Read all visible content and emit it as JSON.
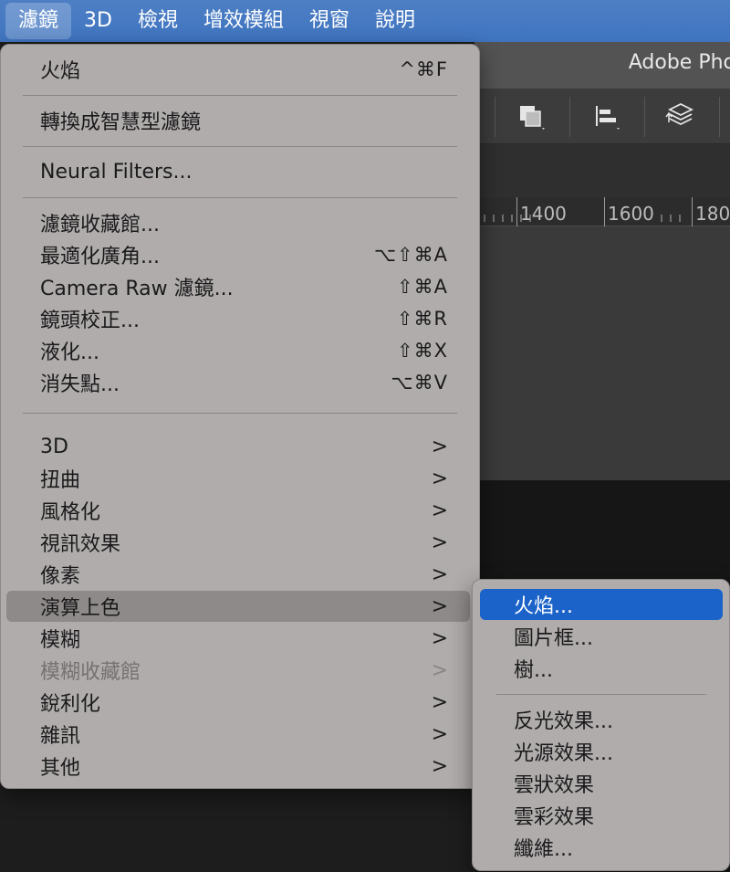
{
  "menubar": {
    "items": [
      "濾鏡",
      "3D",
      "檢視",
      "增效模組",
      "視窗",
      "說明"
    ]
  },
  "app": {
    "title": "Adobe Pho",
    "ruler_labels": [
      "1400",
      "1600",
      "180"
    ]
  },
  "filter_menu": {
    "groups": [
      [
        {
          "label": "火焰",
          "shortcut": "^⌘F"
        }
      ],
      [
        {
          "label": "轉換成智慧型濾鏡",
          "shortcut": ""
        }
      ],
      [
        {
          "label": "Neural Filters...",
          "shortcut": ""
        }
      ],
      [
        {
          "label": "濾鏡收藏館...",
          "shortcut": ""
        },
        {
          "label": "最適化廣角...",
          "shortcut": "⌥⇧⌘A"
        },
        {
          "label": "Camera Raw 濾鏡...",
          "shortcut": "⇧⌘A"
        },
        {
          "label": "鏡頭校正...",
          "shortcut": "⇧⌘R"
        },
        {
          "label": "液化...",
          "shortcut": "⇧⌘X"
        },
        {
          "label": "消失點...",
          "shortcut": "⌥⌘V"
        }
      ],
      [
        {
          "label": "3D",
          "arrow": ">"
        },
        {
          "label": "扭曲",
          "arrow": ">"
        },
        {
          "label": "風格化",
          "arrow": ">"
        },
        {
          "label": "視訊效果",
          "arrow": ">"
        },
        {
          "label": "像素",
          "arrow": ">"
        },
        {
          "label": "演算上色",
          "arrow": ">",
          "highlighted": true
        },
        {
          "label": "模糊",
          "arrow": ">"
        },
        {
          "label": "模糊收藏館",
          "arrow": ">",
          "disabled": true
        },
        {
          "label": "銳利化",
          "arrow": ">"
        },
        {
          "label": "雜訊",
          "arrow": ">"
        },
        {
          "label": "其他",
          "arrow": ">"
        }
      ]
    ]
  },
  "render_submenu": {
    "items": [
      "火焰...",
      "圖片框...",
      "樹...",
      "反光效果...",
      "光源效果...",
      "雲狀效果",
      "雲彩效果",
      "纖維..."
    ],
    "selected": "火焰..."
  }
}
